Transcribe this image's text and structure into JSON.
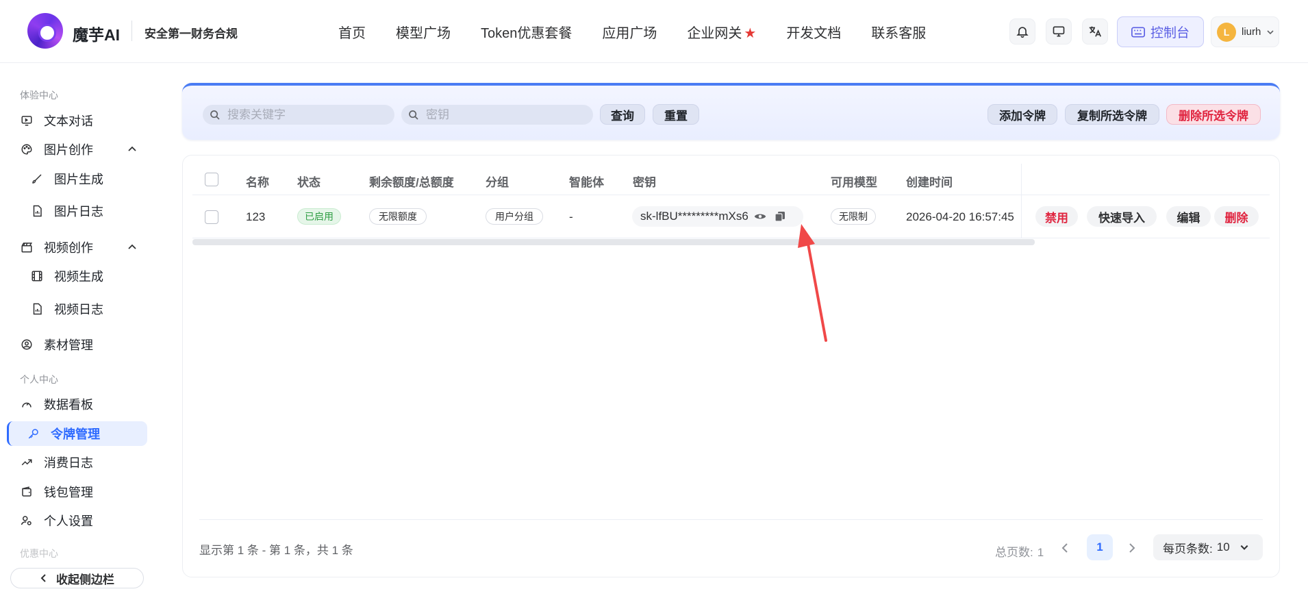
{
  "header": {
    "logo_text": "魔芋AI",
    "slogan": "安全第一财务合规",
    "nav": [
      "首页",
      "模型广场",
      "Token优惠套餐",
      "应用广场",
      "企业网关",
      "开发文档",
      "联系客服"
    ],
    "nav_star": "★",
    "console_label": "控制台",
    "avatar_letter": "L",
    "username": "liurh"
  },
  "sidebar": {
    "section_experience": "体验中心",
    "text_chat": "文本对话",
    "image_create": "图片创作",
    "image_gen": "图片生成",
    "image_log": "图片日志",
    "video_create": "视频创作",
    "video_gen": "视频生成",
    "video_log": "视频日志",
    "material": "素材管理",
    "section_personal": "个人中心",
    "dashboard": "数据看板",
    "token_manage": "令牌管理",
    "consume_log": "消费日志",
    "wallet": "钱包管理",
    "settings": "个人设置",
    "section_promo": "优惠中心",
    "collapse": "收起侧边栏"
  },
  "search": {
    "keyword_placeholder": "搜索关键字",
    "key_placeholder": "密钥",
    "query": "查询",
    "reset": "重置",
    "add_token": "添加令牌",
    "copy_selected": "复制所选令牌",
    "delete_selected": "删除所选令牌"
  },
  "table": {
    "columns": [
      "名称",
      "状态",
      "剩余额度/总额度",
      "分组",
      "智能体",
      "密钥",
      "可用模型",
      "创建时间"
    ],
    "rows": [
      {
        "name": "123",
        "status": "已启用",
        "quota": "无限额度",
        "group": "用户分组",
        "agent": "-",
        "key": "sk-lfBU*********mXs6",
        "models": "无限制",
        "created": "2026-04-20 16:57:45",
        "actions": [
          "禁用",
          "快速导入",
          "编辑",
          "删除"
        ]
      }
    ]
  },
  "footer": {
    "info": "显示第 1 条 - 第 1 条，共 1 条",
    "total_pages_label": "总页数:",
    "total_pages": "1",
    "current_page": "1",
    "page_size_label": "每页条数:",
    "page_size": "10"
  },
  "colors": {
    "accent": "#2f6bff",
    "danger": "#e0243f",
    "success": "#2f9e44",
    "arrow": "#f04848"
  }
}
